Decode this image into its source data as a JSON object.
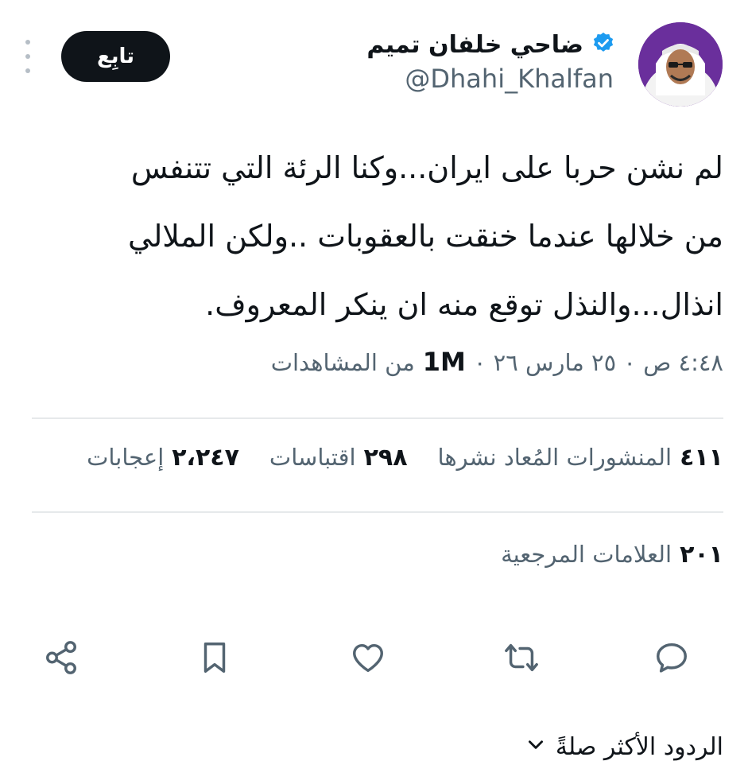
{
  "header": {
    "display_name": "ضاحي خلفان تميم",
    "handle": "@Dhahi_Khalfan",
    "follow_label": "تابِع",
    "verified_color": "#1d9bf0"
  },
  "tweet": {
    "lines": [
      "لم نشن حربا على ايران...وكنا الرئة التي تتنفس",
      "من خلالها عندما خنقت بالعقوبات ..ولكن الملالي",
      "انذال...والنذل توقع منه ان ينكر المعروف."
    ],
    "timestamp": "٤:٤٨ ص ٠ ٢٥ مارس ٢٦ ٠",
    "views_count": "1M",
    "views_label": "من المشاهدات"
  },
  "stats": {
    "reposts_count": "٤١١",
    "reposts_label": "المنشورات المُعاد نشرها",
    "quotes_count": "٢٩٨",
    "quotes_label": "اقتباسات",
    "likes_count": "٢،٢٤٧",
    "likes_label": "إعجابات",
    "bookmarks_count": "٢٠١",
    "bookmarks_label": "العلامات المرجعية"
  },
  "actions": [
    "reply-icon",
    "repost-icon",
    "like-icon",
    "bookmark-icon",
    "share-icon"
  ],
  "bottom": {
    "label": "الردود الأكثر صلةً"
  },
  "colors": {
    "text": "#0f1419",
    "secondary": "#536471",
    "divider": "#e6e9eb",
    "avatar_bg": "#6a2f9c"
  }
}
